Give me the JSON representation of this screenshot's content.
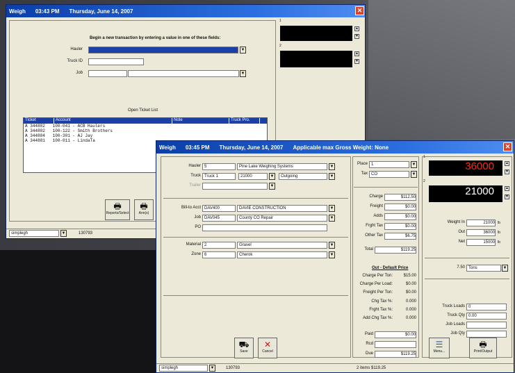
{
  "back_window": {
    "title_app": "Weigh",
    "title_time": "03:43 PM",
    "title_date": "Thursday, June 14, 2007",
    "instruction": "Begin a new transaction by entering a value in one of these fields:",
    "hauler_label": "Hauler",
    "truck_label": "Truck ID",
    "job_label": "Job",
    "display1_num": "1",
    "display2_num": "2",
    "open_ticket_title": "Open Ticket List",
    "list_headers": [
      "Ticket",
      "Account",
      "Note",
      "Truck Pro."
    ],
    "list_rows": [
      "A 344882   100-041 - ACB Haulers",
      "A 344882   100-122 - Smith Brothers",
      "A 344884   100-301 - AJ Jay",
      "A 344881   100-011 - LindaTa"
    ],
    "btn_reports": "Reports/Select",
    "btn_other": "Ann(s)",
    "status_user": "simplegh",
    "status_num": "130793"
  },
  "front_window": {
    "title_app": "Weigh",
    "title_time": "03:45 PM",
    "title_date": "Thursday, June 14, 2007",
    "title_extra": "Applicable max Gross Weight: None",
    "hauler_label": "Hauler",
    "hauler_code": "5",
    "hauler_name": "Pine Lake Weighing Systems",
    "truck_label": "Truck",
    "truck_value": "Truck 1",
    "truck_tare": "21000",
    "truck_dir": "Outgoing",
    "trailer_label": "Trailer",
    "bill_label": "Bill-to Acct",
    "bill_code": "DAV400",
    "bill_name": "DAVIE CONSTRUCTION",
    "job_label": "Job",
    "job_code": "DAV045",
    "job_name": "County CO Repair",
    "po_label": "PO",
    "material_label": "Material",
    "material_code": "2",
    "material_name": "Gravel",
    "zone_label": "Zone",
    "zone_code": "6",
    "zone_name": "Cherok",
    "place_label": "Place",
    "place_value": "1",
    "tax_label": "Tax",
    "tax_value": "CO",
    "charges": [
      {
        "label": "Charge",
        "value": "$112.50"
      },
      {
        "label": "Freight",
        "value": "$0.00"
      },
      {
        "label": "Adds",
        "value": "$0.00"
      },
      {
        "label": "Frght Tax",
        "value": "$0.00"
      },
      {
        "label": "Other Tax",
        "value": "$6.75"
      }
    ],
    "total_label": "Total",
    "total_value": "$119.25",
    "default_title": "Out - Default Price",
    "price_rows": [
      {
        "label": "Charge Per Ton:",
        "value": "$15.00"
      },
      {
        "label": "Charge Per Load:",
        "value": "$0.00"
      },
      {
        "label": "Freight Per Ton:",
        "value": "$0.00"
      },
      {
        "label": "Chg Tax %:",
        "value": "0.000"
      },
      {
        "label": "Frght Tax %:",
        "value": "0.000"
      },
      {
        "label": "Add Chg Tax %:",
        "value": "0.000"
      }
    ],
    "paid_label": "Paid",
    "paid_value": "$0.00",
    "rec_label": "Rcd",
    "due_label": "Due",
    "due_value": "$119.25",
    "scale1_num": "1",
    "scale1_value": "36000",
    "scale2_num": "2",
    "scale2_value": "21000",
    "weight_in_label": "Weight In",
    "weight_in": "21000",
    "out_label": "Out",
    "out_value": "36000",
    "net_label": "Net",
    "net_value": "15000",
    "unit": "lb",
    "unit_count": "7.50",
    "unit_name": "Tons",
    "truck_loads_label": "Truck Loads",
    "truck_loads": "0",
    "truck_qty_label": "Truck Qty",
    "truck_qty": "0.00",
    "job_loads_label": "Job Loads",
    "job_qty_label": "Job Qty",
    "btn_save": "Save",
    "btn_cancel": "Cancel",
    "btn_menu": "Menu...",
    "btn_print": "Print/Output",
    "status_user": "simplegh",
    "status_num": "130793",
    "status_summary": "2 items   $119.25"
  }
}
